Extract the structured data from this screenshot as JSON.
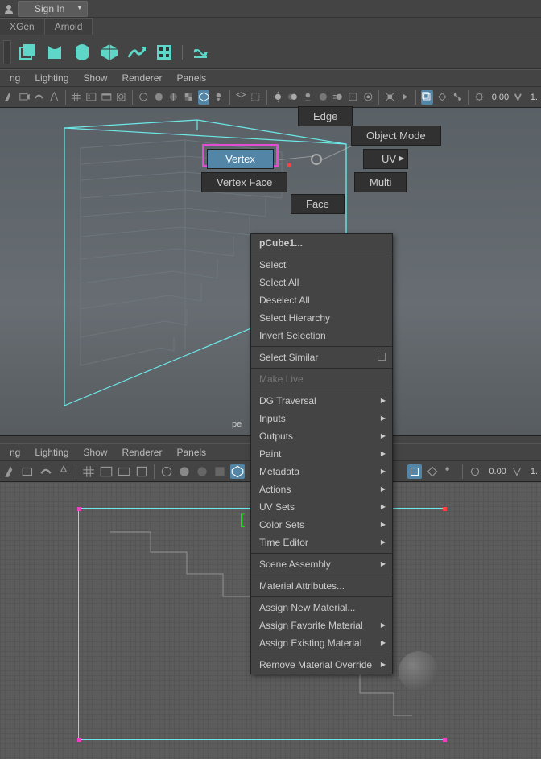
{
  "top": {
    "signin_label": "Sign In",
    "tabs": [
      "XGen",
      "Arnold"
    ]
  },
  "vp_menu": {
    "items": [
      "ng",
      "Lighting",
      "Show",
      "Renderer",
      "Panels"
    ]
  },
  "toolbar": {
    "num_top": "0.00",
    "one_top": "1.",
    "num_bot": "0.00",
    "one_bot": "1."
  },
  "marking": {
    "edge": "Edge",
    "vertex": "Vertex",
    "vertex_face": "Vertex Face",
    "face": "Face",
    "object_mode": "Object Mode",
    "uv": "UV",
    "multi": "Multi"
  },
  "persp_label": "pe",
  "context": {
    "title": "pCube1...",
    "items_a": [
      "Select",
      "Select All",
      "Deselect All",
      "Select Hierarchy",
      "Invert Selection"
    ],
    "select_similar": "Select Similar",
    "make_live": "Make Live",
    "items_b": [
      "DG Traversal",
      "Inputs",
      "Outputs",
      "Paint",
      "Metadata",
      "Actions",
      "UV Sets",
      "Color Sets",
      "Time Editor"
    ],
    "scene_assembly": "Scene Assembly",
    "mat_attr": "Material Attributes...",
    "items_c": [
      "Assign New Material...",
      "Assign Favorite Material",
      "Assign Existing Material"
    ],
    "remove_override": "Remove Material Override"
  },
  "colors": {
    "teal": "#5ed6c8",
    "magenta": "#e64cd3",
    "cyan": "#6ce8e8"
  }
}
